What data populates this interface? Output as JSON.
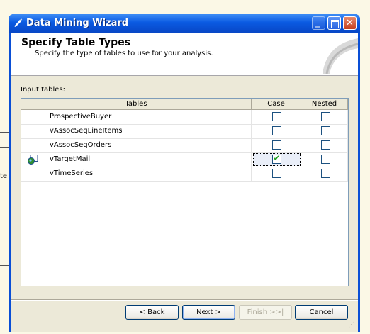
{
  "window": {
    "title": "Data Mining Wizard"
  },
  "header": {
    "title": "Specify Table Types",
    "subtitle": "Specify the type of tables to use for your analysis."
  },
  "input_tables_label": "Input tables:",
  "grid": {
    "columns": [
      "Tables",
      "Case",
      "Nested"
    ],
    "rows": [
      {
        "name": "ProspectiveBuyer",
        "case": false,
        "nested": false,
        "icon": ""
      },
      {
        "name": "vAssocSeqLineItems",
        "case": false,
        "nested": false,
        "icon": ""
      },
      {
        "name": "vAssocSeqOrders",
        "case": false,
        "nested": false,
        "icon": ""
      },
      {
        "name": "vTargetMail",
        "case": true,
        "nested": false,
        "icon": "case-table-icon"
      },
      {
        "name": "vTimeSeries",
        "case": false,
        "nested": false,
        "icon": ""
      }
    ]
  },
  "buttons": {
    "back": "< Back",
    "next": "Next >",
    "finish": "Finish >>|",
    "cancel": "Cancel"
  },
  "background": {
    "partial_text": "te"
  },
  "colors": {
    "titlebar": "#0a5ae2",
    "dialog": "#ece9d8",
    "check": "#21a121"
  }
}
